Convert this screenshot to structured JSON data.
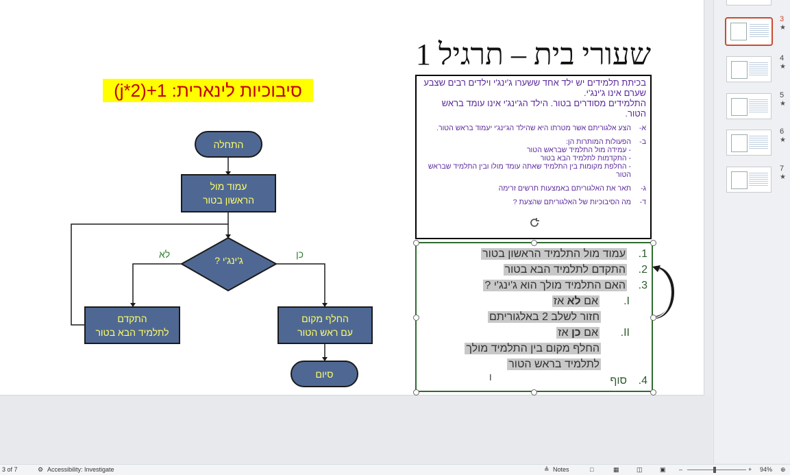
{
  "slide": {
    "title": "שעורי בית – תרגיל 1",
    "complexity": "סיבוכיות לינארית:  j*2)+1)",
    "task_intro": [
      "בכיתת תלמידים יש ילד אחד ששערו ג'ינג'י וילדים רבים שצבע שערם אינו ג'ינג'י.",
      "התלמידים מסודרים בטור. הילד הג'ינג'י אינו עומד בראש הטור."
    ],
    "task_items": [
      {
        "key": "א-",
        "lines": [
          "הצע אלגוריתם אשר מטרתו היא שהילד הג'ינג'י יעמוד בראש הטור."
        ]
      },
      {
        "key": "ב-",
        "lines": [
          "הפעולות המותרות הן:",
          "- עמידה מול התלמיד שבראש הטור",
          "- התקדמות לתלמיד הבא בטור",
          "- החלפת מקומות בין התלמיד שאתה עומד מולו ובין התלמיד שבראש הטור"
        ]
      },
      {
        "key": "ג-",
        "lines": [
          "תאר את האלגוריתם באמצעות תרשים זרימה"
        ]
      },
      {
        "key": "ד-",
        "lines": [
          "מה הסיבוכיות של האלגוריתם שהצעת ?"
        ]
      }
    ],
    "algorithm": [
      {
        "num": "1.",
        "text": "עמוד מול התלמיד הראשון בטור"
      },
      {
        "num": "2.",
        "text": "התקדם לתלמיד הבא בטור"
      },
      {
        "num": "3.",
        "text": "האם התלמיד מולך הוא ג'ינג'י ?"
      },
      {
        "num": "I.",
        "pre": "אם ",
        "bold": "לא",
        "post": " אז"
      },
      {
        "num": "",
        "text": "חזור לשלב 2 באלגוריתם"
      },
      {
        "num": "II.",
        "pre": "אם ",
        "bold": "כן",
        "post": " אז"
      },
      {
        "num": "",
        "text": "החלף מקום בין התלמיד מולך"
      },
      {
        "num": "",
        "text": "לתלמיד בראש הטור"
      },
      {
        "num": "4.",
        "text": "סוף"
      }
    ],
    "flowchart": {
      "start": "התחלה",
      "stand": "עמוד מול\nהראשון בטור",
      "decision": "ג'ינג'י ?",
      "no_label": "לא",
      "yes_label": "כן",
      "advance": "התקדם\nלתלמיד הבא בטור",
      "swap": "החלף מקום\nעם ראש הטור",
      "end": "סיום"
    }
  },
  "thumbnails": [
    {
      "num": "3",
      "active": true
    },
    {
      "num": "4",
      "active": false
    },
    {
      "num": "5",
      "active": false
    },
    {
      "num": "6",
      "active": false
    },
    {
      "num": "7",
      "active": false
    }
  ],
  "status_bar": {
    "slide_counter": "3 of 7",
    "accessibility": "Accessibility: Investigate",
    "notes": "Notes",
    "zoom": "94%"
  },
  "colors": {
    "title_text": "#111111",
    "complexity_highlight": "#ffff00",
    "complexity_text": "#c00000",
    "task_text": "#5a2a9a",
    "algo_text": "#2d5a2d",
    "flow_fill": "#4f6893",
    "flow_text": "#ffff66",
    "active_thumb": "#c94a2f"
  }
}
